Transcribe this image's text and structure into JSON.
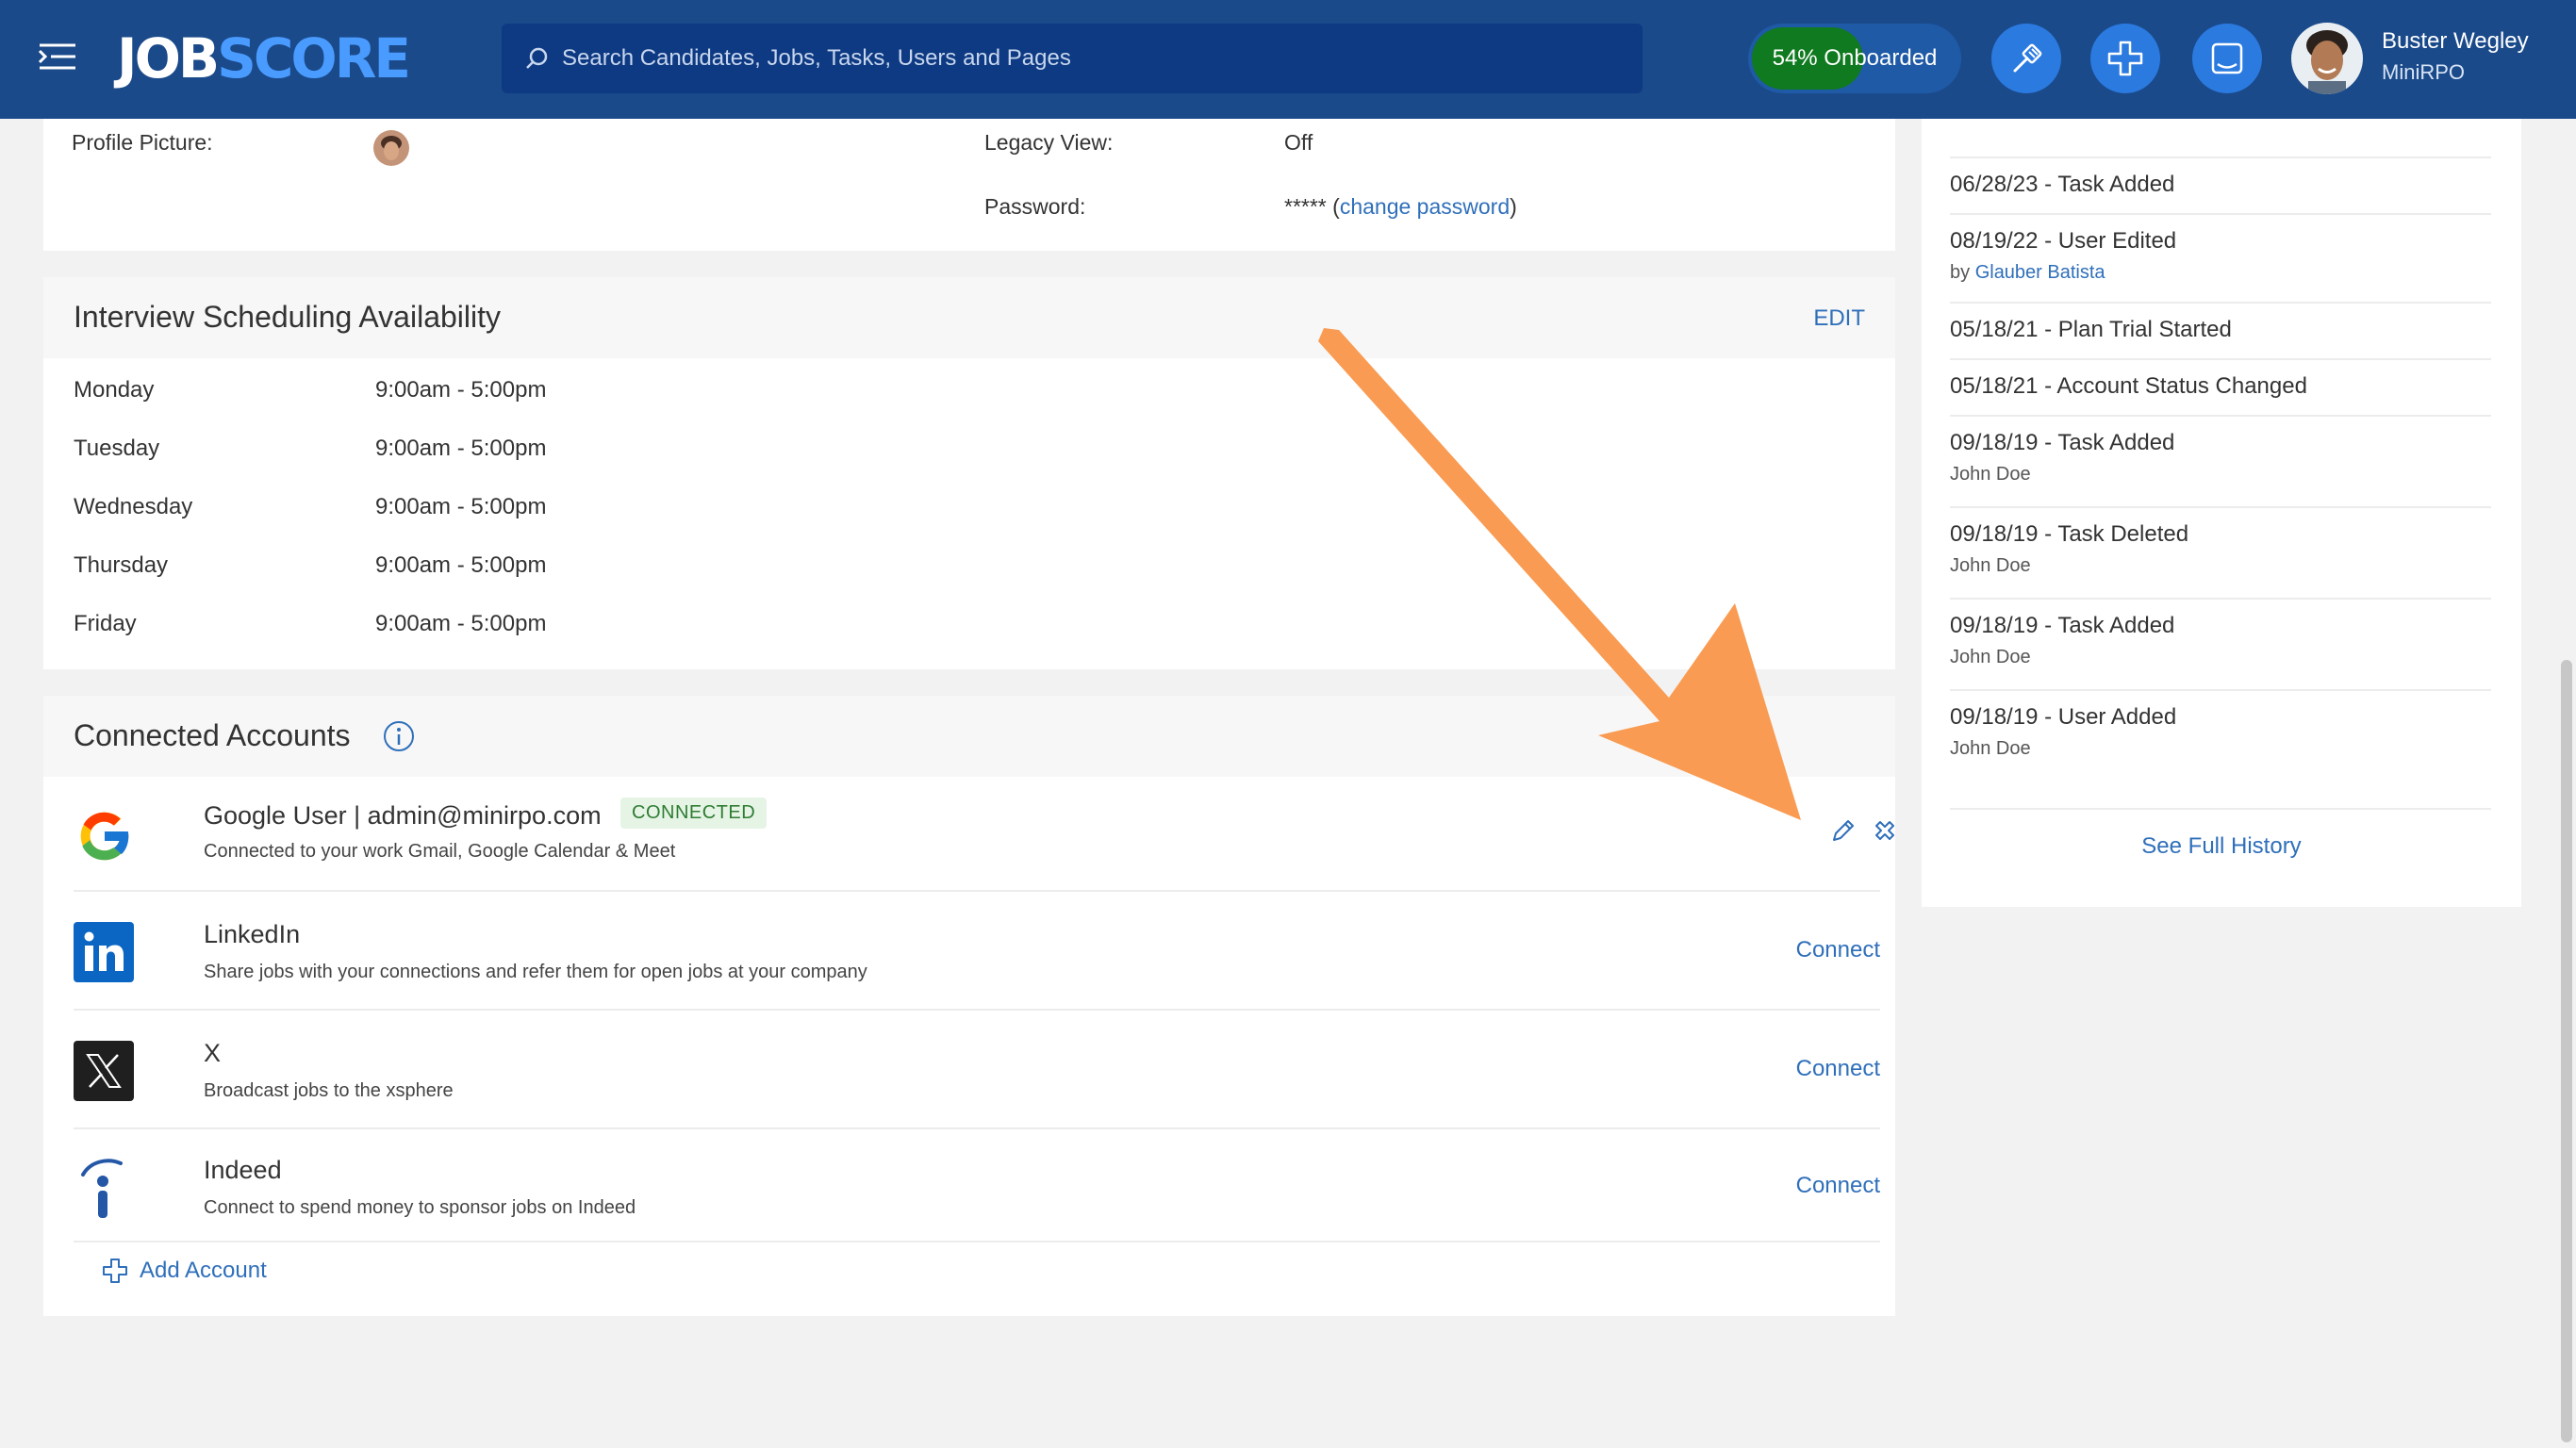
{
  "header": {
    "logo_part1": "JOB",
    "logo_part2": "SCORE",
    "search_placeholder": "Search Candidates, Jobs, Tasks, Users and Pages",
    "onboarded_label": "54% Onboarded",
    "onboarded_progress": 0.54,
    "user_name": "Buster Wegley",
    "user_org": "MiniRPO"
  },
  "profile": {
    "profile_picture_label": "Profile Picture:",
    "legacy_view_label": "Legacy View:",
    "legacy_view_value": "Off",
    "password_label": "Password:",
    "password_mask": "*****",
    "paren_open": "(",
    "change_password": "change password",
    "paren_close": ")"
  },
  "availability": {
    "title": "Interview Scheduling Availability",
    "edit_label": "EDIT",
    "days": [
      {
        "day": "Monday",
        "hours": "9:00am - 5:00pm"
      },
      {
        "day": "Tuesday",
        "hours": "9:00am - 5:00pm"
      },
      {
        "day": "Wednesday",
        "hours": "9:00am - 5:00pm"
      },
      {
        "day": "Thursday",
        "hours": "9:00am - 5:00pm"
      },
      {
        "day": "Friday",
        "hours": "9:00am - 5:00pm"
      }
    ]
  },
  "connected": {
    "title": "Connected Accounts",
    "google": {
      "name": "Google User | admin@minirpo.com",
      "badge": "CONNECTED",
      "desc": "Connected to your work Gmail, Google Calendar & Meet"
    },
    "linkedin": {
      "name": "LinkedIn",
      "desc": "Share jobs with your connections and refer them for open jobs at your company",
      "action": "Connect"
    },
    "x": {
      "name": "X",
      "desc": "Broadcast jobs to the xsphere",
      "action": "Connect"
    },
    "indeed": {
      "name": "Indeed",
      "desc": "Connect to spend money to sponsor jobs on Indeed",
      "action": "Connect"
    },
    "add_account": "Add Account"
  },
  "history": {
    "items": [
      {
        "title": "06/28/23 - Task Added"
      },
      {
        "title": "08/19/22 - User Edited",
        "by": "by",
        "user": "Glauber Batista"
      },
      {
        "title": "05/18/21 - Plan Trial Started"
      },
      {
        "title": "05/18/21 - Account Status Changed"
      },
      {
        "title": "09/18/19 - Task Added",
        "user": "John Doe"
      },
      {
        "title": "09/18/19 - Task Deleted",
        "user": "John Doe"
      },
      {
        "title": "09/18/19 - Task Added",
        "user": "John Doe"
      },
      {
        "title": "09/18/19 - User Added",
        "user": "John Doe"
      }
    ],
    "see_full_history": "See Full History"
  },
  "colors": {
    "header_bg": "#1a4a8a",
    "accent_link": "#2f6fba",
    "onboard_fill": "#0f7a1f",
    "annotation_arrow": "#f99b52"
  }
}
